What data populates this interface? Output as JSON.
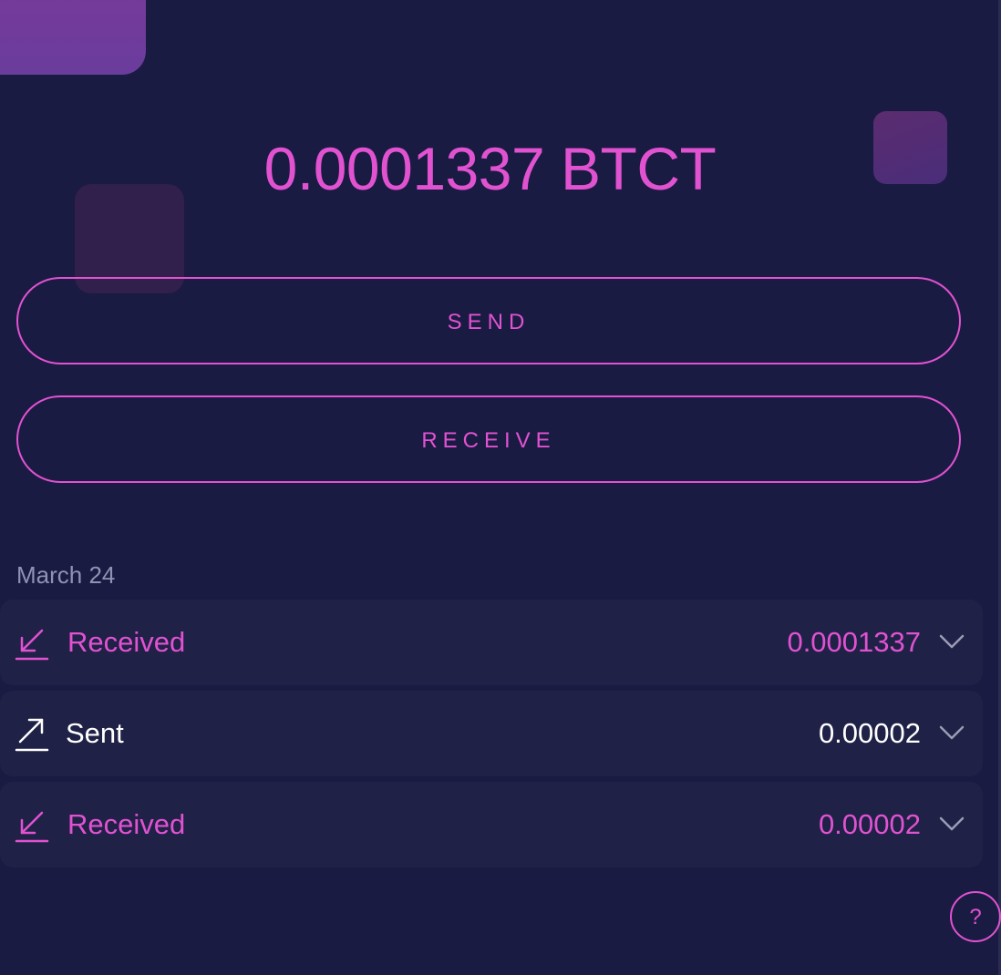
{
  "balance": {
    "amount": "0.0001337",
    "currency": "BTCT",
    "display": "0.0001337 BTCT"
  },
  "actions": {
    "send_label": "SEND",
    "receive_label": "RECEIVE"
  },
  "transactions": {
    "date_heading": "March 24",
    "items": [
      {
        "type": "Received",
        "amount": "0.0001337",
        "icon": "arrow-down-left-icon",
        "color": "#e152d1"
      },
      {
        "type": "Sent",
        "amount": "0.00002",
        "icon": "arrow-up-right-icon",
        "color": "#ffffff"
      },
      {
        "type": "Received",
        "amount": "0.00002",
        "icon": "arrow-down-left-icon",
        "color": "#e152d1"
      }
    ]
  },
  "help": {
    "label": "?"
  },
  "colors": {
    "background": "#1a1b42",
    "accent": "#e152d1",
    "row_background": "#1f2147",
    "muted_text": "#8f93b3"
  }
}
